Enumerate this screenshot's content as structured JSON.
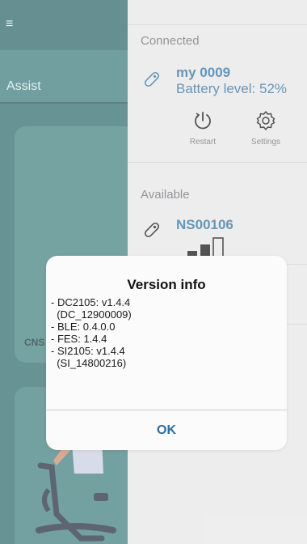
{
  "left_app": {
    "menu_icon": "menu-icon",
    "tab_label": "Assist",
    "card_label": "CNS"
  },
  "panel": {
    "connected": {
      "heading": "Connected",
      "device_name": "my 0009",
      "battery_text": "Battery level: 52%",
      "restart_label": "Restart",
      "settings_label": "Settings"
    },
    "available": {
      "heading": "Available",
      "device_name": "NS00106"
    }
  },
  "dialog": {
    "title": "Version info",
    "lines": [
      "- DC2105: v1.4.4",
      "  (DC_12900009)",
      "- BLE: 0.4.0.0",
      "- FES: 1.4.4",
      "- SI2105: v1.4.4",
      "  (SI_14800216)"
    ],
    "ok_label": "OK"
  },
  "colors": {
    "accent": "#2d6d9c",
    "teal": "#2f6a6c",
    "panel_bg": "#e7e7e8"
  }
}
